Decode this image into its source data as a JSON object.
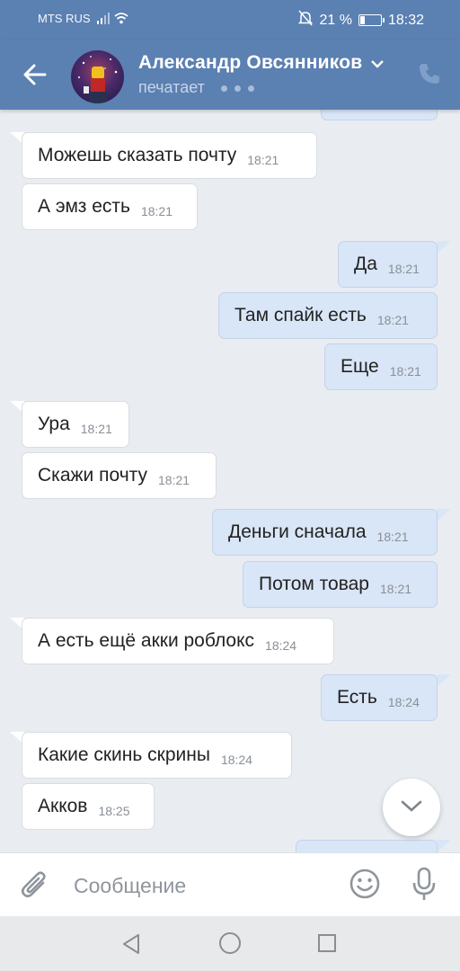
{
  "status_bar": {
    "carrier": "MTS RUS",
    "battery": "21 %",
    "battery_level": 0.21,
    "time": "18:32"
  },
  "header": {
    "name": "Александр Овсянников",
    "status": "печатает"
  },
  "messages": [
    {
      "dir": "in",
      "text": "Можешь сказать почту",
      "time": "18:21"
    },
    {
      "dir": "in",
      "text": "А эмз есть",
      "time": "18:21"
    },
    {
      "dir": "out",
      "text": "Да",
      "time": "18:21"
    },
    {
      "dir": "out",
      "text": "Там спайк есть",
      "time": "18:21"
    },
    {
      "dir": "out",
      "text": "Еще",
      "time": "18:21"
    },
    {
      "dir": "in",
      "text": "Ура",
      "time": "18:21"
    },
    {
      "dir": "in",
      "text": "Скажи почту",
      "time": "18:21"
    },
    {
      "dir": "out",
      "text": "Деньги сначала",
      "time": "18:21"
    },
    {
      "dir": "out",
      "text": "Потом товар",
      "time": "18:21"
    },
    {
      "dir": "in",
      "text": "А есть ещё акки роблокс",
      "time": "18:24"
    },
    {
      "dir": "out",
      "text": "Есть",
      "time": "18:24"
    },
    {
      "dir": "in",
      "text": "Какие скинь скрины",
      "time": "18:24"
    },
    {
      "dir": "in",
      "text": "Акков",
      "time": "18:25"
    }
  ],
  "composer": {
    "placeholder": "Сообщение"
  },
  "colors": {
    "header": "#5b80b2",
    "background": "#e9edf2",
    "bubble_in": "#ffffff",
    "bubble_out": "#d9e6f7"
  },
  "icons": [
    "back-arrow-icon",
    "chevron-down-icon",
    "phone-icon",
    "scroll-down-icon",
    "attach-icon",
    "emoji-icon",
    "mic-icon",
    "nav-back-icon",
    "nav-home-icon",
    "nav-recent-icon"
  ]
}
